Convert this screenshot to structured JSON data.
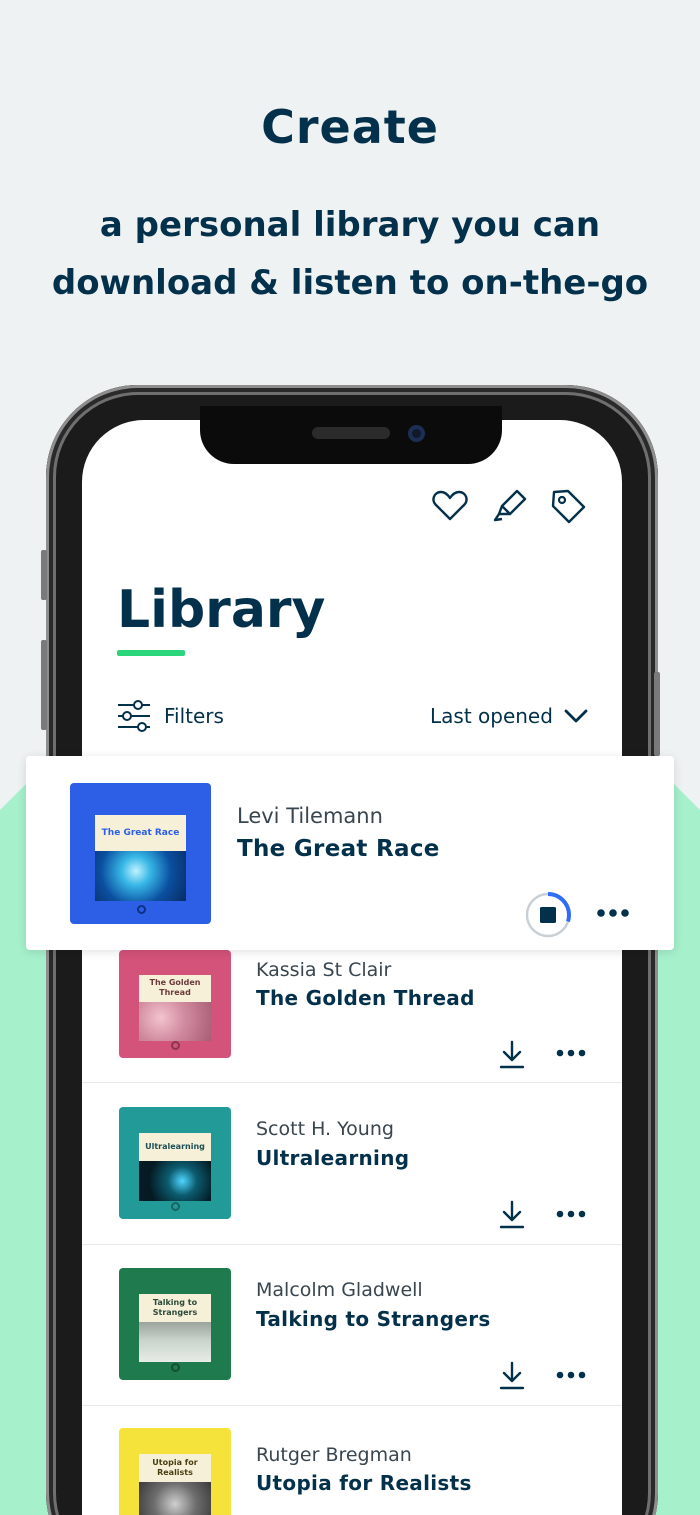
{
  "hero": {
    "title": "Create",
    "subtitle_line1": "a personal library you can",
    "subtitle_line2": "download & listen to on-the-go"
  },
  "toolbar": {
    "icons": [
      "heart-icon",
      "highlighter-icon",
      "tag-icon"
    ]
  },
  "library": {
    "title": "Library",
    "filters_label": "Filters",
    "sort_label": "Last opened"
  },
  "now_playing": {
    "author": "Levi Tilemann",
    "title": "The Great Race",
    "cover_label": "The Great Race",
    "cover_color": "#2d5fe6",
    "progress": 0.3
  },
  "books": [
    {
      "author": "Kassia St Clair",
      "title": "The Golden Thread",
      "cover_label": "The Golden Thread",
      "cover_color": "#d4537a"
    },
    {
      "author": "Scott H. Young",
      "title": "Ultralearning",
      "cover_label": "Ultralearning",
      "cover_color": "#229a98"
    },
    {
      "author": "Malcolm Gladwell",
      "title": "Talking to Strangers",
      "cover_label": "Talking to Strangers",
      "cover_color": "#1f7a4d"
    },
    {
      "author": "Rutger Bregman",
      "title": "Utopia for Realists",
      "cover_label": "Utopia for Realists",
      "cover_color": "#f5e23a"
    }
  ],
  "colors": {
    "brand_dark": "#03314b",
    "accent_green": "#2bd67b",
    "progress_blue": "#2f6df6"
  }
}
